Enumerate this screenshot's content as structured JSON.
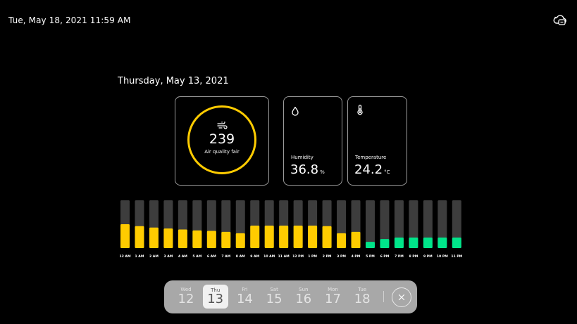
{
  "status_bar": {
    "datetime": "Tue, May 18, 2021 11:59 AM",
    "connection_icon": "cloud-icon"
  },
  "selected_date": "Thursday, May 13, 2021",
  "air_quality": {
    "value": "239",
    "label": "Air quality fair",
    "icon": "wind-icon",
    "ring_color": "#ffcc00"
  },
  "humidity": {
    "label": "Humidity",
    "value": "36.8",
    "unit": "%",
    "icon": "droplet-icon"
  },
  "temperature": {
    "label": "Temperature",
    "value": "24.2",
    "unit": "°C",
    "icon": "thermometer-icon"
  },
  "chart_data": {
    "type": "bar",
    "categories": [
      "12 AM",
      "1 AM",
      "2 AM",
      "3 AM",
      "4 AM",
      "5 AM",
      "6 AM",
      "7 AM",
      "8 AM",
      "9 AM",
      "10 AM",
      "11 AM",
      "12 PM",
      "1 PM",
      "2 PM",
      "3 PM",
      "4 PM",
      "5 PM",
      "6 PM",
      "7 PM",
      "8 PM",
      "9 PM",
      "10 PM",
      "11 PM"
    ],
    "values": [
      0.5,
      0.46,
      0.43,
      0.41,
      0.39,
      0.37,
      0.36,
      0.34,
      0.31,
      0.47,
      0.47,
      0.47,
      0.47,
      0.47,
      0.46,
      0.31,
      0.34,
      0.13,
      0.19,
      0.22,
      0.22,
      0.22,
      0.22,
      0.22
    ],
    "colors": [
      "#ffcc00",
      "#ffcc00",
      "#ffcc00",
      "#ffcc00",
      "#ffcc00",
      "#ffcc00",
      "#ffcc00",
      "#ffcc00",
      "#ffcc00",
      "#ffcc00",
      "#ffcc00",
      "#ffcc00",
      "#ffcc00",
      "#ffcc00",
      "#ffcc00",
      "#ffcc00",
      "#ffcc00",
      "#00e58a",
      "#00e58a",
      "#00e58a",
      "#00e58a",
      "#00e58a",
      "#00e58a",
      "#00e58a"
    ],
    "track_color": "#3d3d3d",
    "ylim": [
      0,
      1
    ],
    "grid": false
  },
  "day_picker": {
    "days": [
      {
        "name": "Wed",
        "num": "12"
      },
      {
        "name": "Thu",
        "num": "13"
      },
      {
        "name": "Fri",
        "num": "14"
      },
      {
        "name": "Sat",
        "num": "15"
      },
      {
        "name": "Sun",
        "num": "16"
      },
      {
        "name": "Mon",
        "num": "17"
      },
      {
        "name": "Tue",
        "num": "18"
      }
    ],
    "selected_index": 1,
    "close_icon": "close-icon"
  }
}
